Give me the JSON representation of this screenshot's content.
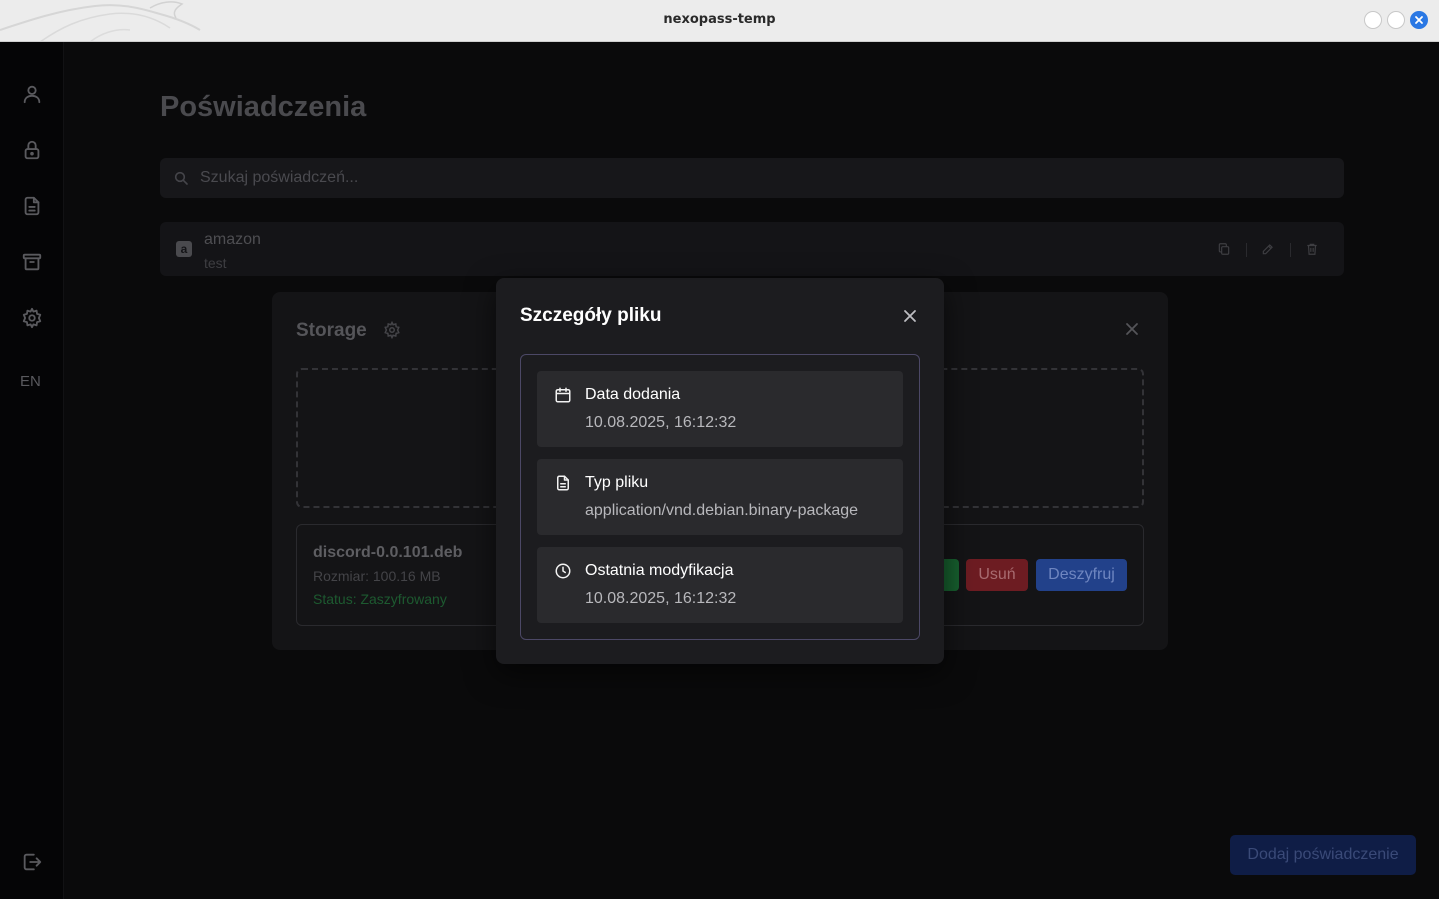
{
  "window": {
    "title": "nexopass-temp"
  },
  "sidebar": {
    "items": [
      {
        "icon": "user-icon"
      },
      {
        "icon": "lock-icon"
      },
      {
        "icon": "document-icon"
      },
      {
        "icon": "archive-icon"
      },
      {
        "icon": "gear-icon"
      }
    ],
    "language": "EN",
    "logout_icon": "logout-icon"
  },
  "main": {
    "title": "Poświadczenia",
    "search": {
      "placeholder": "Szukaj poświadczeń...",
      "value": ""
    },
    "credentials": [
      {
        "name": "amazon",
        "subtitle": "test",
        "icon": "amazon-icon"
      }
    ],
    "add_button": "Dodaj poświadczenie"
  },
  "storage_modal": {
    "title": "Storage",
    "file": {
      "name": "discord-0.0.101.deb",
      "size": "Rozmiar: 100.16 MB",
      "status": "Status: Zaszyfrowany"
    },
    "buttons": {
      "delete": "Usuń",
      "decrypt": "Deszyfruj"
    }
  },
  "details_modal": {
    "title": "Szczegóły pliku",
    "rows": [
      {
        "icon": "calendar-icon",
        "label": "Data dodania",
        "value": "10.08.2025, 16:12:32"
      },
      {
        "icon": "file-icon",
        "label": "Typ pliku",
        "value": "application/vnd.debian.binary-package"
      },
      {
        "icon": "clock-icon",
        "label": "Ostatnia modyfikacja",
        "value": "10.08.2025, 16:12:32"
      }
    ]
  },
  "colors": {
    "accent": "#2a78e4",
    "status_green": "#1d5a30",
    "danger": "#6d1c22",
    "primary": "#22418a",
    "modal_bg": "#1c1c1f",
    "details_border": "#4c4866"
  }
}
